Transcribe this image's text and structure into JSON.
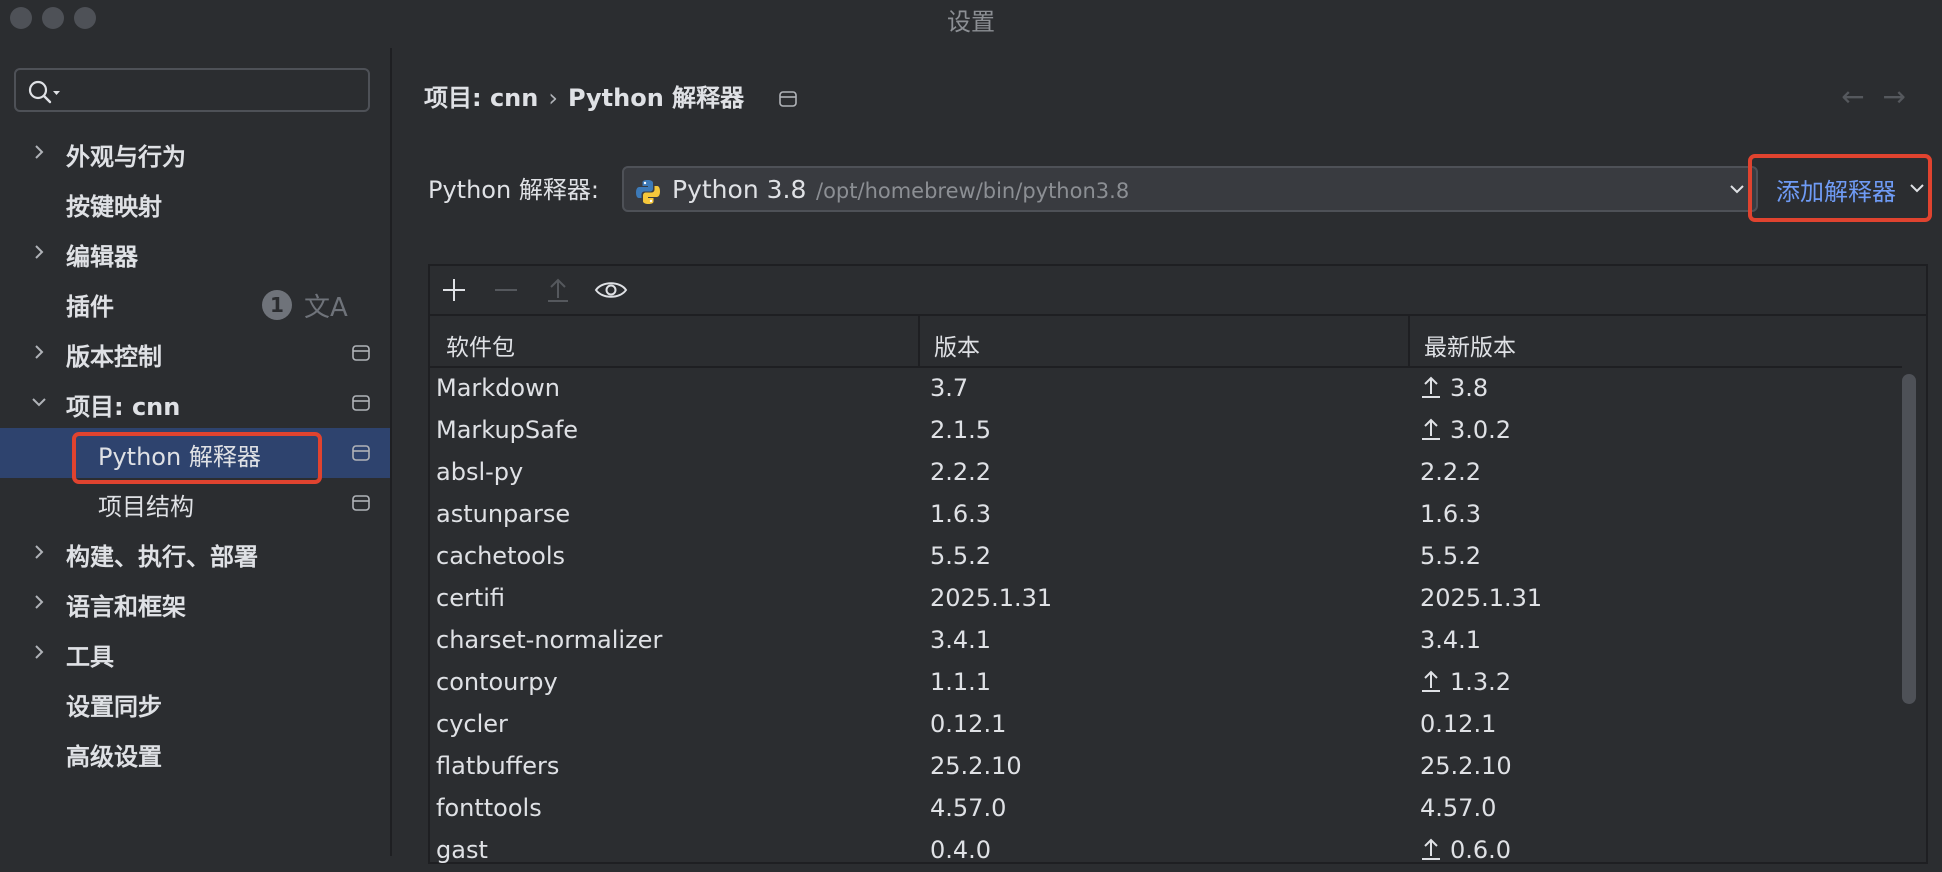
{
  "window": {
    "title": "设置"
  },
  "sidebar": {
    "search": {
      "placeholder": ""
    },
    "items": [
      {
        "label": "外观与行为",
        "expandable": true
      },
      {
        "label": "按键映射",
        "expandable": false
      },
      {
        "label": "编辑器",
        "expandable": true
      },
      {
        "label": "插件",
        "expandable": false,
        "badge": "1"
      },
      {
        "label": "版本控制",
        "expandable": true,
        "project_icon": true
      },
      {
        "label": "项目: cnn",
        "expandable": true,
        "expanded": true,
        "project_icon": true
      },
      {
        "label": "Python 解释器",
        "child": true,
        "selected": true,
        "project_icon": true
      },
      {
        "label": "项目结构",
        "child": true,
        "project_icon": true
      },
      {
        "label": "构建、执行、部署",
        "expandable": true
      },
      {
        "label": "语言和框架",
        "expandable": true
      },
      {
        "label": "工具",
        "expandable": true
      },
      {
        "label": "设置同步",
        "expandable": false
      },
      {
        "label": "高级设置",
        "expandable": false
      }
    ]
  },
  "breadcrumb": {
    "project": "项目: cnn",
    "separator": "›",
    "page": "Python 解释器"
  },
  "interpreter": {
    "label": "Python 解释器:",
    "version": "Python 3.8",
    "path": "/opt/homebrew/bin/python3.8",
    "add_button": "添加解释器"
  },
  "packages": {
    "columns": [
      "软件包",
      "版本",
      "最新版本"
    ],
    "rows": [
      {
        "name": "Markdown",
        "version": "3.7",
        "latest": "3.8",
        "upgrade": true
      },
      {
        "name": "MarkupSafe",
        "version": "2.1.5",
        "latest": "3.0.2",
        "upgrade": true
      },
      {
        "name": "absl-py",
        "version": "2.2.2",
        "latest": "2.2.2",
        "upgrade": false
      },
      {
        "name": "astunparse",
        "version": "1.6.3",
        "latest": "1.6.3",
        "upgrade": false
      },
      {
        "name": "cachetools",
        "version": "5.5.2",
        "latest": "5.5.2",
        "upgrade": false
      },
      {
        "name": "certifi",
        "version": "2025.1.31",
        "latest": "2025.1.31",
        "upgrade": false
      },
      {
        "name": "charset-normalizer",
        "version": "3.4.1",
        "latest": "3.4.1",
        "upgrade": false
      },
      {
        "name": "contourpy",
        "version": "1.1.1",
        "latest": "1.3.2",
        "upgrade": true
      },
      {
        "name": "cycler",
        "version": "0.12.1",
        "latest": "0.12.1",
        "upgrade": false
      },
      {
        "name": "flatbuffers",
        "version": "25.2.10",
        "latest": "25.2.10",
        "upgrade": false
      },
      {
        "name": "fonttools",
        "version": "4.57.0",
        "latest": "4.57.0",
        "upgrade": false
      },
      {
        "name": "gast",
        "version": "0.4.0",
        "latest": "0.6.0",
        "upgrade": true
      }
    ]
  },
  "colors": {
    "accent": "#6f9bf5",
    "selection": "#2e436e",
    "highlight": "#e0432f"
  },
  "icons": [
    "search-icon",
    "chevron-right-icon",
    "chevron-down-icon",
    "project-icon",
    "translate-icon",
    "plus-icon",
    "minus-icon",
    "upgrade-icon",
    "eye-icon",
    "back-arrow-icon",
    "forward-arrow-icon",
    "python-icon"
  ]
}
